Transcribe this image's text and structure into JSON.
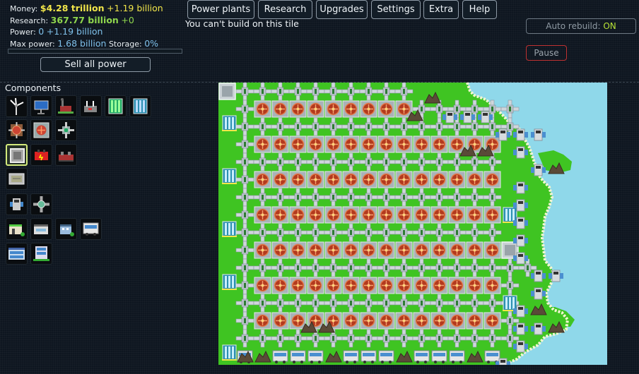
{
  "stats": {
    "money_label": "Money:",
    "money_value": "$4.28 trillion",
    "money_rate": "+1.19 billion",
    "research_label": "Research:",
    "research_value": "367.77 billion",
    "research_rate": "+0",
    "power_label": "Power:",
    "power_value": "0",
    "power_rate": "+1.19 billion",
    "maxpower_label": "Max power:",
    "maxpower_value": "1.68 billion",
    "storage_label": "Storage:",
    "storage_value": "0%",
    "power_fill": 0
  },
  "sell_button": "Sell all power",
  "nav": [
    "Power plants",
    "Research",
    "Upgrades",
    "Settings",
    "Extra",
    "Help"
  ],
  "message": "You can't build on this tile",
  "auto_rebuild": {
    "label": "Auto rebuild:",
    "state": "ON"
  },
  "pause_button": "Pause",
  "components_title": "Components",
  "components": [
    [
      "wind-turbine-icon",
      "solar-panel-icon",
      "coal-plant-icon",
      "gas-plant-icon",
      "fuel-rod-icon",
      "heat-exchanger-icon"
    ],
    [
      "reactor-core-icon",
      "heat-vent-icon",
      "heat-inlet-icon"
    ],
    [
      "battery-icon",
      "dynamite-icon",
      "generator-icon"
    ],
    [
      "circuit-board-icon"
    ],
    [
      "cooling-unit-icon",
      "pump-icon"
    ],
    [
      "small-office-icon",
      "shop-icon",
      "house-icon",
      "bus-icon"
    ],
    [
      "apartment-icon",
      "office-building-icon"
    ]
  ],
  "selected_component": "battery-icon",
  "colors": {
    "grass": "#3fc422",
    "water": "#8fd8ea",
    "pipe": "#cfd6dc",
    "reactor": "#b33a1e",
    "accent_yellow": "#f2e64a",
    "accent_green": "#8fd64d"
  }
}
